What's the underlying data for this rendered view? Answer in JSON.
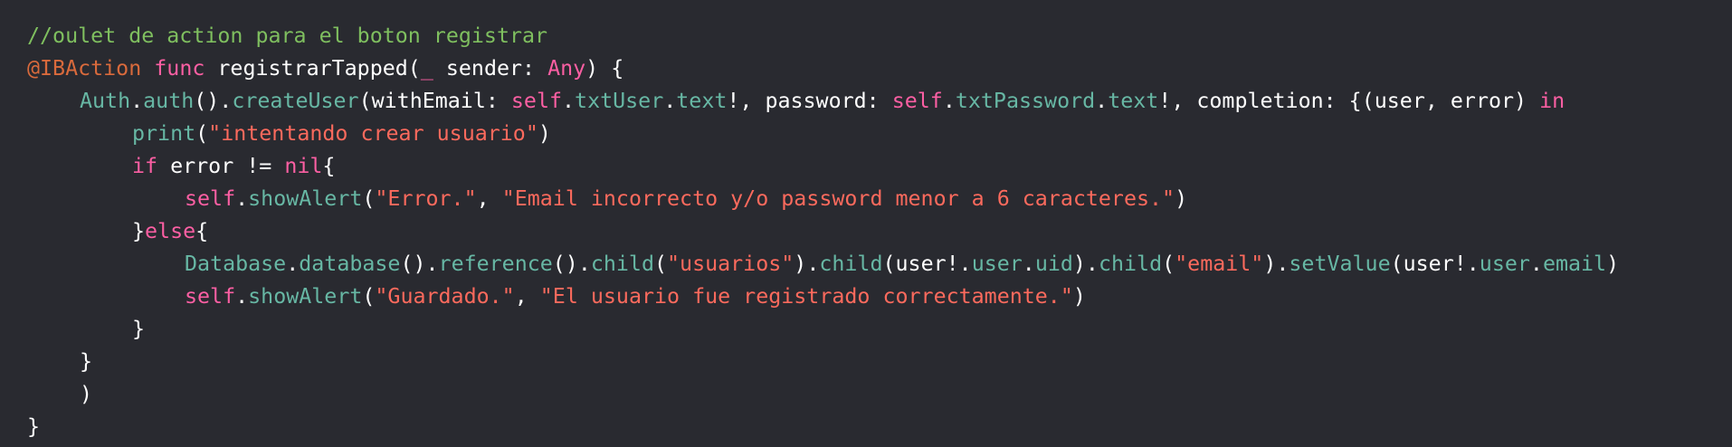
{
  "colors": {
    "background": "#292a30",
    "comment": "#7fbf5f",
    "attribute": "#d96a3c",
    "keyword": "#fc5fa3",
    "type": "#5dd8ff",
    "identifier": "#67b7a4",
    "string": "#fc6a5d",
    "plain": "#ffffff"
  },
  "code": [
    {
      "indent": 0,
      "tokens": [
        {
          "t": "//oulet de action para el boton registrar",
          "c": "comment"
        }
      ]
    },
    {
      "indent": 0,
      "tokens": [
        {
          "t": "@IBAction",
          "c": "attr"
        },
        {
          "t": " ",
          "c": "plain"
        },
        {
          "t": "func",
          "c": "kw"
        },
        {
          "t": " registrarTapped(",
          "c": "plain"
        },
        {
          "t": "_",
          "c": "kw"
        },
        {
          "t": " sender: ",
          "c": "plain"
        },
        {
          "t": "Any",
          "c": "kw"
        },
        {
          "t": ") {",
          "c": "plain"
        }
      ]
    },
    {
      "indent": 1,
      "tokens": [
        {
          "t": "Auth",
          "c": "teal"
        },
        {
          "t": ".",
          "c": "plain"
        },
        {
          "t": "auth",
          "c": "teal"
        },
        {
          "t": "().",
          "c": "plain"
        },
        {
          "t": "createUser",
          "c": "teal"
        },
        {
          "t": "(withEmail: ",
          "c": "plain"
        },
        {
          "t": "self",
          "c": "kw"
        },
        {
          "t": ".",
          "c": "plain"
        },
        {
          "t": "txtUser",
          "c": "teal"
        },
        {
          "t": ".",
          "c": "plain"
        },
        {
          "t": "text",
          "c": "teal"
        },
        {
          "t": "!, password: ",
          "c": "plain"
        },
        {
          "t": "self",
          "c": "kw"
        },
        {
          "t": ".",
          "c": "plain"
        },
        {
          "t": "txtPassword",
          "c": "teal"
        },
        {
          "t": ".",
          "c": "plain"
        },
        {
          "t": "text",
          "c": "teal"
        },
        {
          "t": "!, completion: {(user, error) ",
          "c": "plain"
        },
        {
          "t": "in",
          "c": "kw"
        }
      ]
    },
    {
      "indent": 2,
      "tokens": [
        {
          "t": "print",
          "c": "teal"
        },
        {
          "t": "(",
          "c": "plain"
        },
        {
          "t": "\"intentando crear usuario\"",
          "c": "str"
        },
        {
          "t": ")",
          "c": "plain"
        }
      ]
    },
    {
      "indent": 2,
      "tokens": [
        {
          "t": "if",
          "c": "kw"
        },
        {
          "t": " error != ",
          "c": "plain"
        },
        {
          "t": "nil",
          "c": "kw"
        },
        {
          "t": "{",
          "c": "plain"
        }
      ]
    },
    {
      "indent": 3,
      "tokens": [
        {
          "t": "self",
          "c": "kw"
        },
        {
          "t": ".",
          "c": "plain"
        },
        {
          "t": "showAlert",
          "c": "teal"
        },
        {
          "t": "(",
          "c": "plain"
        },
        {
          "t": "\"Error.\"",
          "c": "str"
        },
        {
          "t": ", ",
          "c": "plain"
        },
        {
          "t": "\"Email incorrecto y/o password menor a 6 caracteres.\"",
          "c": "str"
        },
        {
          "t": ")",
          "c": "plain"
        }
      ]
    },
    {
      "indent": 2,
      "tokens": [
        {
          "t": "}",
          "c": "plain"
        },
        {
          "t": "else",
          "c": "kw"
        },
        {
          "t": "{",
          "c": "plain"
        }
      ]
    },
    {
      "indent": 3,
      "tokens": [
        {
          "t": "Database",
          "c": "teal"
        },
        {
          "t": ".",
          "c": "plain"
        },
        {
          "t": "database",
          "c": "teal"
        },
        {
          "t": "().",
          "c": "plain"
        },
        {
          "t": "reference",
          "c": "teal"
        },
        {
          "t": "().",
          "c": "plain"
        },
        {
          "t": "child",
          "c": "teal"
        },
        {
          "t": "(",
          "c": "plain"
        },
        {
          "t": "\"usuarios\"",
          "c": "str"
        },
        {
          "t": ").",
          "c": "plain"
        },
        {
          "t": "child",
          "c": "teal"
        },
        {
          "t": "(user!.",
          "c": "plain"
        },
        {
          "t": "user",
          "c": "teal"
        },
        {
          "t": ".",
          "c": "plain"
        },
        {
          "t": "uid",
          "c": "teal"
        },
        {
          "t": ").",
          "c": "plain"
        },
        {
          "t": "child",
          "c": "teal"
        },
        {
          "t": "(",
          "c": "plain"
        },
        {
          "t": "\"email\"",
          "c": "str"
        },
        {
          "t": ").",
          "c": "plain"
        },
        {
          "t": "setValue",
          "c": "teal"
        },
        {
          "t": "(user!.",
          "c": "plain"
        },
        {
          "t": "user",
          "c": "teal"
        },
        {
          "t": ".",
          "c": "plain"
        },
        {
          "t": "email",
          "c": "teal"
        },
        {
          "t": ")",
          "c": "plain"
        }
      ]
    },
    {
      "indent": 3,
      "tokens": [
        {
          "t": "self",
          "c": "kw"
        },
        {
          "t": ".",
          "c": "plain"
        },
        {
          "t": "showAlert",
          "c": "teal"
        },
        {
          "t": "(",
          "c": "plain"
        },
        {
          "t": "\"Guardado.\"",
          "c": "str"
        },
        {
          "t": ", ",
          "c": "plain"
        },
        {
          "t": "\"El usuario fue registrado correctamente.\"",
          "c": "str"
        },
        {
          "t": ")",
          "c": "plain"
        }
      ]
    },
    {
      "indent": 2,
      "tokens": [
        {
          "t": "}",
          "c": "plain"
        }
      ]
    },
    {
      "indent": 1,
      "tokens": [
        {
          "t": "}",
          "c": "plain"
        }
      ]
    },
    {
      "indent": 1,
      "tokens": [
        {
          "t": ")",
          "c": "plain"
        }
      ]
    },
    {
      "indent": 0,
      "tokens": [
        {
          "t": "}",
          "c": "plain"
        }
      ]
    }
  ]
}
